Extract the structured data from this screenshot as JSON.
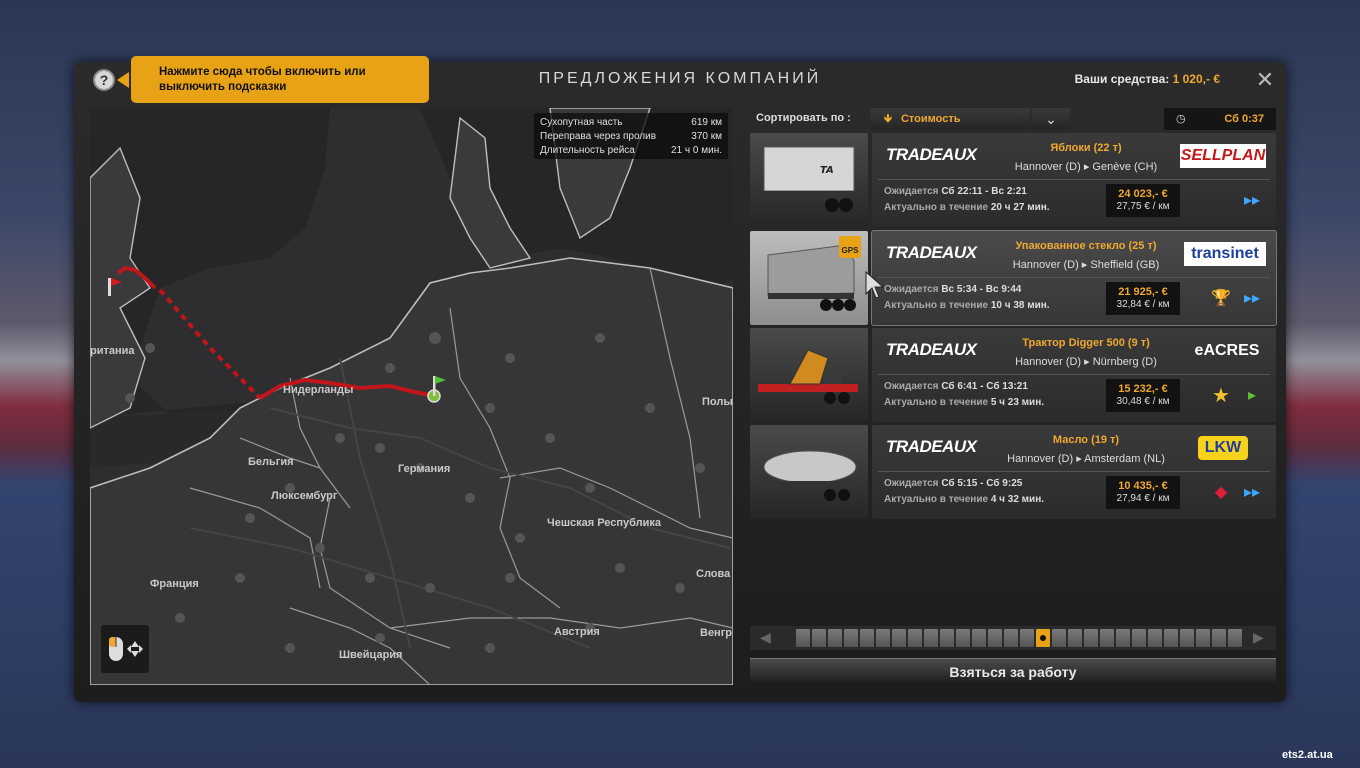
{
  "help": {
    "icon_label": "?",
    "tooltip_line1": "Нажмите сюда чтобы включить или",
    "tooltip_line2": "выключить подсказки"
  },
  "window": {
    "title": "ПРЕДЛОЖЕНИЯ КОМПАНИЙ",
    "funds_label": "Ваши средства:",
    "funds_value": "1 020,- €",
    "close_label": "✕"
  },
  "route_info": [
    {
      "label": "Сухопутная часть",
      "value": "619 км"
    },
    {
      "label": "Переправа через пролив",
      "value": "370 км"
    },
    {
      "label": "Длительность рейса",
      "value": "21 ч 0 мин."
    }
  ],
  "map_labels": {
    "uk": "ританиа",
    "nl": "Нидерланды",
    "be": "Бельгия",
    "lu": "Люксембург",
    "de": "Германия",
    "cz": "Чешская Республика",
    "fr": "Франция",
    "ch": "Швейцария",
    "at": "Австрия",
    "pl": "Полы",
    "sk": "Слова",
    "hu": "Венгр"
  },
  "sort": {
    "label": "Сортировать по :",
    "value": "Стоимость",
    "arrow": "🡻"
  },
  "clock": {
    "time": "Сб 0:37"
  },
  "jobs": [
    {
      "company": "TRADEAUX",
      "cargo": "Яблоки (22 т)",
      "route": "Hannover (D)  ▸  Genève (CH)",
      "client": "SELLPLAN",
      "exp_label": "Ожидается",
      "exp_value": "Сб 22:11 - Вс 2:21",
      "act_label": "Актуально в течение",
      "act_value": "20 ч 27 мин.",
      "price": "24 023,- €",
      "perkm": "27,75 € / км",
      "icon1": "",
      "icon2": "▸▸"
    },
    {
      "company": "TRADEAUX",
      "cargo": "Упакованное стекло (25 т)",
      "route": "Hannover (D)  ▸  Sheffield (GB)",
      "client": "transinet",
      "exp_label": "Ожидается",
      "exp_value": "Вс 5:34 - Вс 9:44",
      "act_label": "Актуально в течение",
      "act_value": "10 ч 38 мин.",
      "price": "21 925,- €",
      "perkm": "32,84 € / км",
      "icon1": "🏆",
      "icon2": "▸▸",
      "badge": "GPS"
    },
    {
      "company": "TRADEAUX",
      "cargo": "Трактор Digger 500 (9 т)",
      "route": "Hannover (D)  ▸  Nürnberg (D)",
      "client": "eACRES",
      "exp_label": "Ожидается",
      "exp_value": "Сб 6:41 - Сб 13:21",
      "act_label": "Актуально в течение",
      "act_value": "5 ч 23 мин.",
      "price": "15 232,- €",
      "perkm": "30,48 € / км",
      "icon1": "★",
      "icon2": "▸"
    },
    {
      "company": "TRADEAUX",
      "cargo": "Масло (19 т)",
      "route": "Hannover (D)  ▸  Amsterdam (NL)",
      "client": "LKW",
      "exp_label": "Ожидается",
      "exp_value": "Сб 5:15 - Сб 9:25",
      "act_label": "Актуально в течение",
      "act_value": "4 ч 32 мин.",
      "price": "10 435,- €",
      "perkm": "27,94 € / км",
      "icon1": "◆",
      "icon2": "▸▸"
    }
  ],
  "take_job": "Взяться за работу",
  "watermark": "ets2.at.ua",
  "colors": {
    "accent": "#f0a830",
    "tooltip": "#e8a215",
    "route": "#c0151b"
  }
}
